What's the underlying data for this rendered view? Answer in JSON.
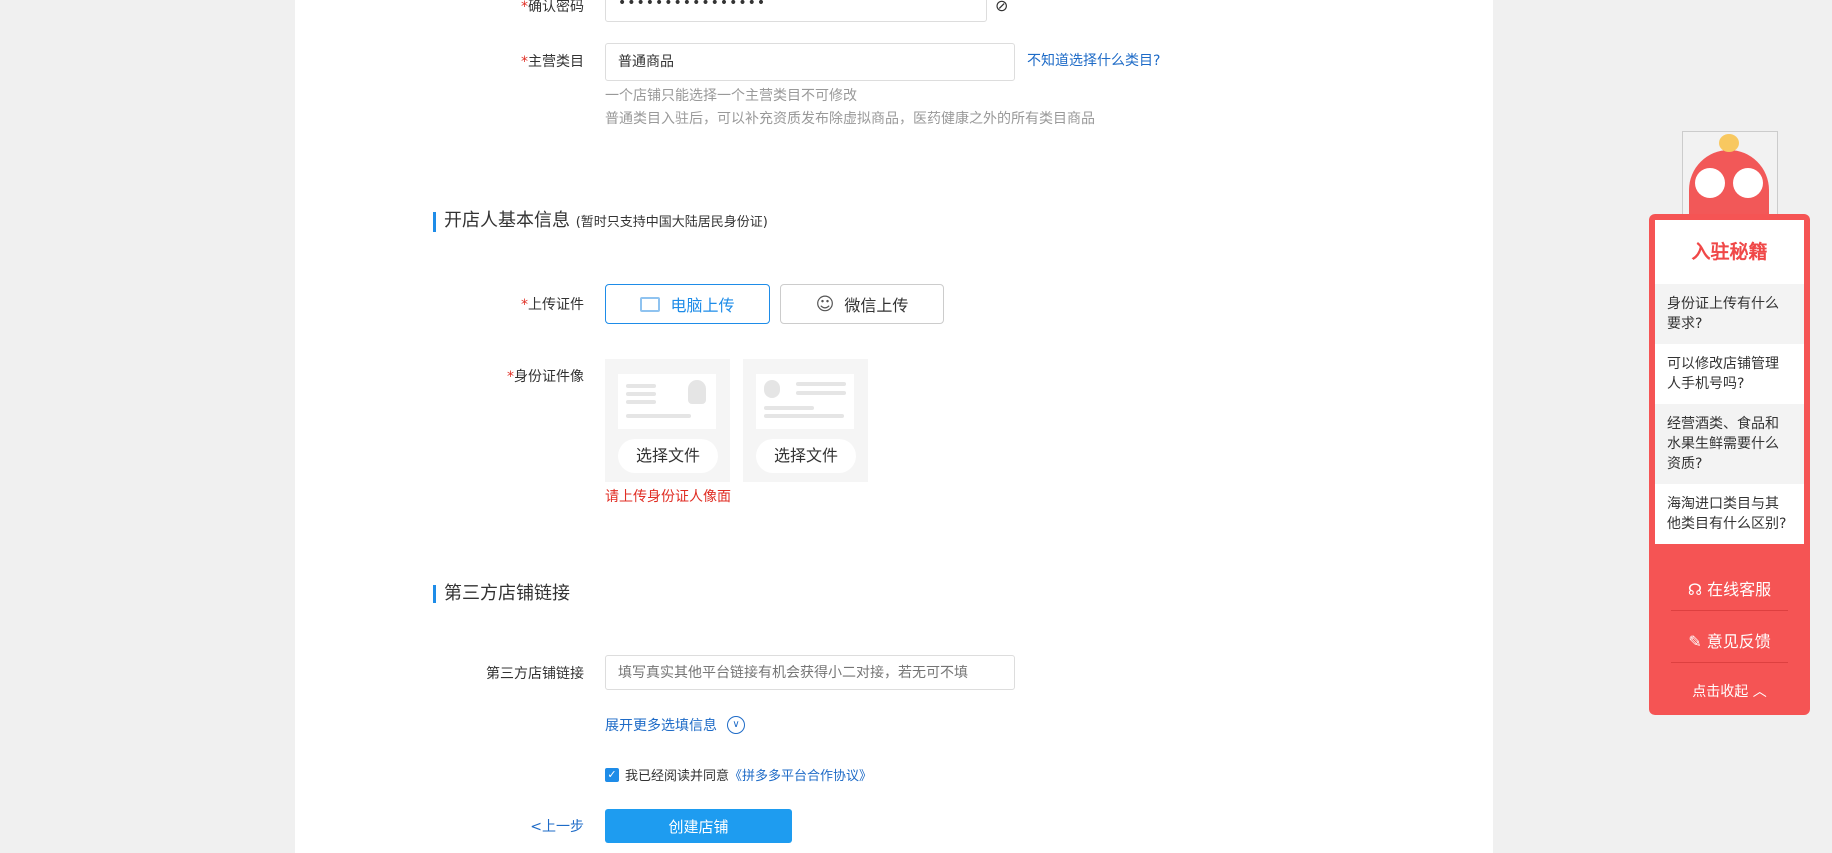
{
  "form": {
    "confirm_password": {
      "label": "确认密码",
      "value": "••••••••••••••••"
    },
    "category": {
      "label": "主营类目",
      "value": "普通商品",
      "help_link": "不知道选择什么类目?",
      "hints": [
        "一个店铺只能选择一个主营类目不可修改",
        "普通类目入驻后，可以补充资质发布除虚拟商品，医药健康之外的所有类目商品"
      ]
    },
    "owner_section": {
      "title": "开店人基本信息",
      "note": "(暂时只支持中国大陆居民身份证)"
    },
    "upload": {
      "label": "上传证件",
      "pc": "电脑上传",
      "wechat": "微信上传"
    },
    "id_photo": {
      "label": "身份证件像",
      "pick1": "选择文件",
      "pick2": "选择文件",
      "error": "请上传身份证人像面"
    },
    "third_section": {
      "title": "第三方店铺链接"
    },
    "third_link": {
      "label": "第三方店铺链接",
      "placeholder": "填写真实其他平台链接有机会获得小二对接，若无可不填",
      "value": ""
    },
    "expand": "展开更多选填信息",
    "agree": {
      "text": "我已经阅读并同意",
      "link": "《拼多多平台合作协议》",
      "checked": true
    },
    "prev": "<上一步",
    "create": "创建店铺"
  },
  "sidebar": {
    "title": "入驻秘籍",
    "questions": [
      "身份证上传有什么要求?",
      "可以修改店铺管理人手机号吗?",
      "经营酒类、食品和水果生鲜需要什么资质?",
      "海淘进口类目与其他类目有什么区别?"
    ],
    "service": "在线客服",
    "feedback": "意见反馈",
    "collapse": "点击收起"
  },
  "colors": {
    "accent": "#1e8ce8",
    "sidebar": "#f55454",
    "error": "#e02e24"
  }
}
